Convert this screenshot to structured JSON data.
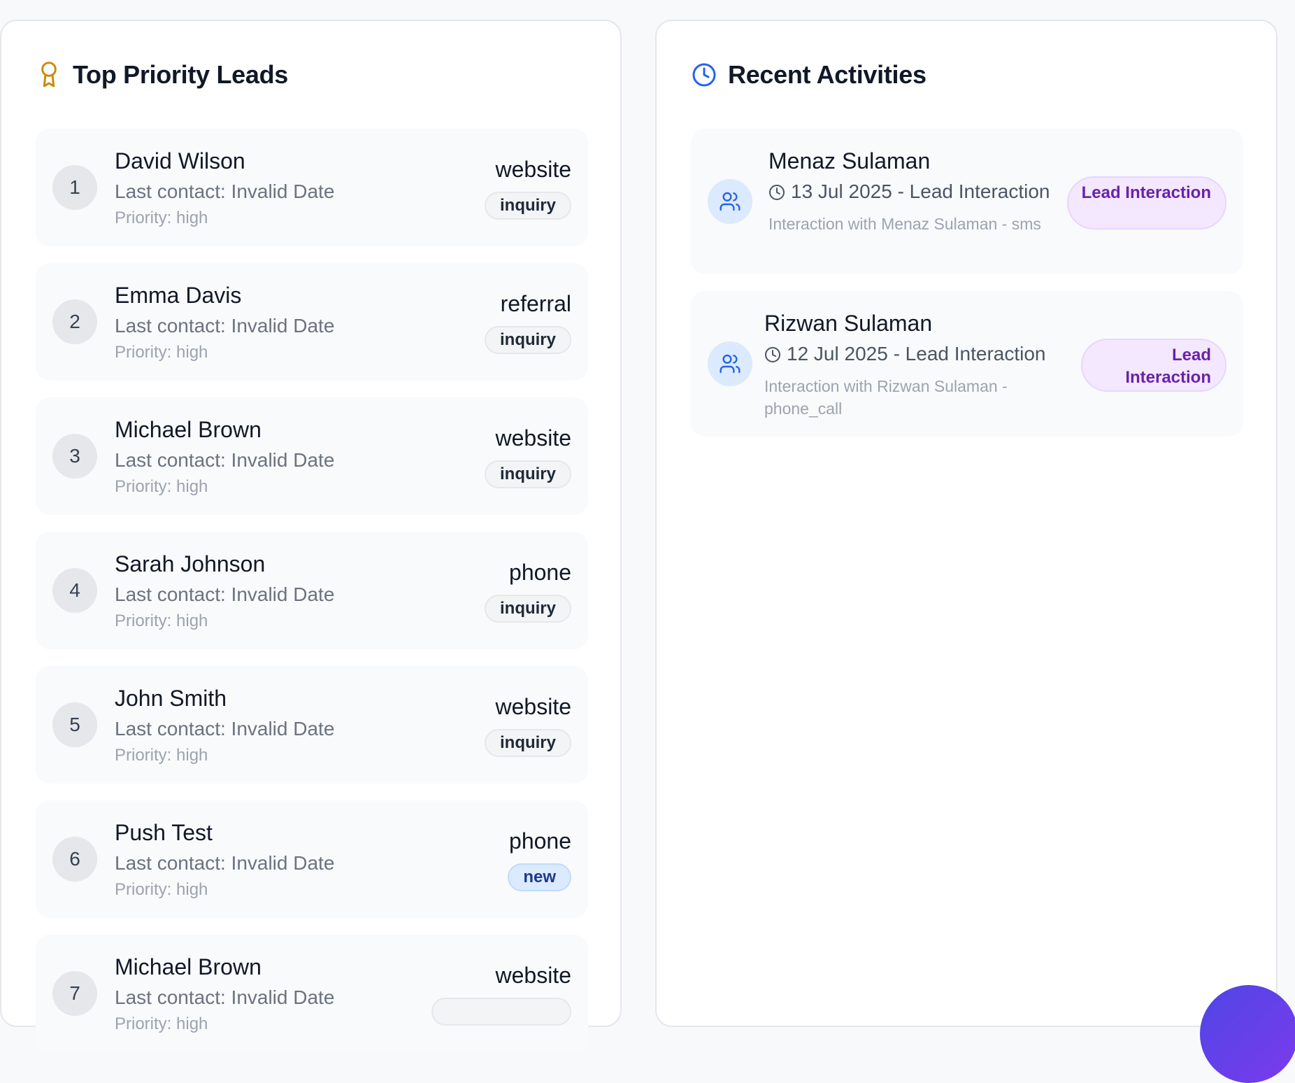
{
  "leads_panel": {
    "title": "Top Priority Leads",
    "icon": "award-icon",
    "leads": [
      {
        "rank": "1",
        "name": "David Wilson",
        "last_contact": "Last contact: Invalid Date",
        "priority": "Priority: high",
        "source": "website",
        "status": "inquiry"
      },
      {
        "rank": "2",
        "name": "Emma Davis",
        "last_contact": "Last contact: Invalid Date",
        "priority": "Priority: high",
        "source": "referral",
        "status": "inquiry"
      },
      {
        "rank": "3",
        "name": "Michael Brown",
        "last_contact": "Last contact: Invalid Date",
        "priority": "Priority: high",
        "source": "website",
        "status": "inquiry"
      },
      {
        "rank": "4",
        "name": "Sarah Johnson",
        "last_contact": "Last contact: Invalid Date",
        "priority": "Priority: high",
        "source": "phone",
        "status": "inquiry"
      },
      {
        "rank": "5",
        "name": "John Smith",
        "last_contact": "Last contact: Invalid Date",
        "priority": "Priority: high",
        "source": "website",
        "status": "inquiry"
      },
      {
        "rank": "6",
        "name": "Push Test",
        "last_contact": "Last contact: Invalid Date",
        "priority": "Priority: high",
        "source": "phone",
        "status": "new"
      },
      {
        "rank": "7",
        "name": "Michael Brown",
        "last_contact": "Last contact: Invalid Date",
        "priority": "Priority: high",
        "source": "website",
        "status": ""
      }
    ]
  },
  "activities_panel": {
    "title": "Recent Activities",
    "icon": "clock-icon",
    "activities": [
      {
        "name": "Menaz Sulaman",
        "meta": "13 Jul 2025 - Lead Interaction",
        "description": "Interaction with Menaz Sulaman - sms",
        "badge": "Lead Interaction"
      },
      {
        "name": "Rizwan Sulaman",
        "meta": "12 Jul 2025 - Lead Interaction",
        "description": "Interaction with Rizwan Sulaman - phone_call",
        "badge": "Lead Interaction"
      }
    ]
  },
  "colors": {
    "accent_gold": "#ca8a04",
    "accent_blue": "#2563eb",
    "badge_purple": "#6b21a8",
    "fab_gradient_start": "#4f46e5",
    "fab_gradient_end": "#7c3aed"
  }
}
